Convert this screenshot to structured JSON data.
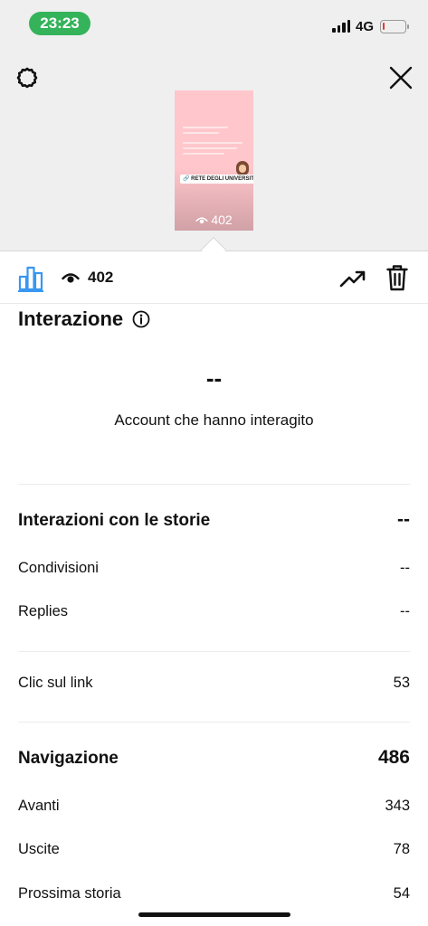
{
  "status_bar": {
    "time": "23:23",
    "network": "4G",
    "battery_level": 0.1,
    "battery_color": "#e53935",
    "time_pill_color": "#34b35a"
  },
  "header": {
    "settings_icon": "gear-icon",
    "close_icon": "close-icon"
  },
  "story_thumbnail": {
    "sticker_text": "🔗 RETE DEGLI UNIVERSITARI",
    "views": "402"
  },
  "toolbar": {
    "views": "402",
    "accent": "#3897f0"
  },
  "interaction": {
    "title": "Interazione",
    "accounts_value": "--",
    "accounts_label": "Account che hanno interagito"
  },
  "story_interactions": {
    "title": "Interazioni con le storie",
    "value": "--",
    "rows": [
      {
        "label": "Condivisioni",
        "value": "--"
      },
      {
        "label": "Replies",
        "value": "--"
      }
    ]
  },
  "link_clicks": {
    "label": "Clic sul link",
    "value": "53"
  },
  "navigation": {
    "title": "Navigazione",
    "value": "486",
    "rows": [
      {
        "label": "Avanti",
        "value": "343"
      },
      {
        "label": "Uscite",
        "value": "78"
      },
      {
        "label": "Prossima storia",
        "value": "54"
      }
    ]
  }
}
